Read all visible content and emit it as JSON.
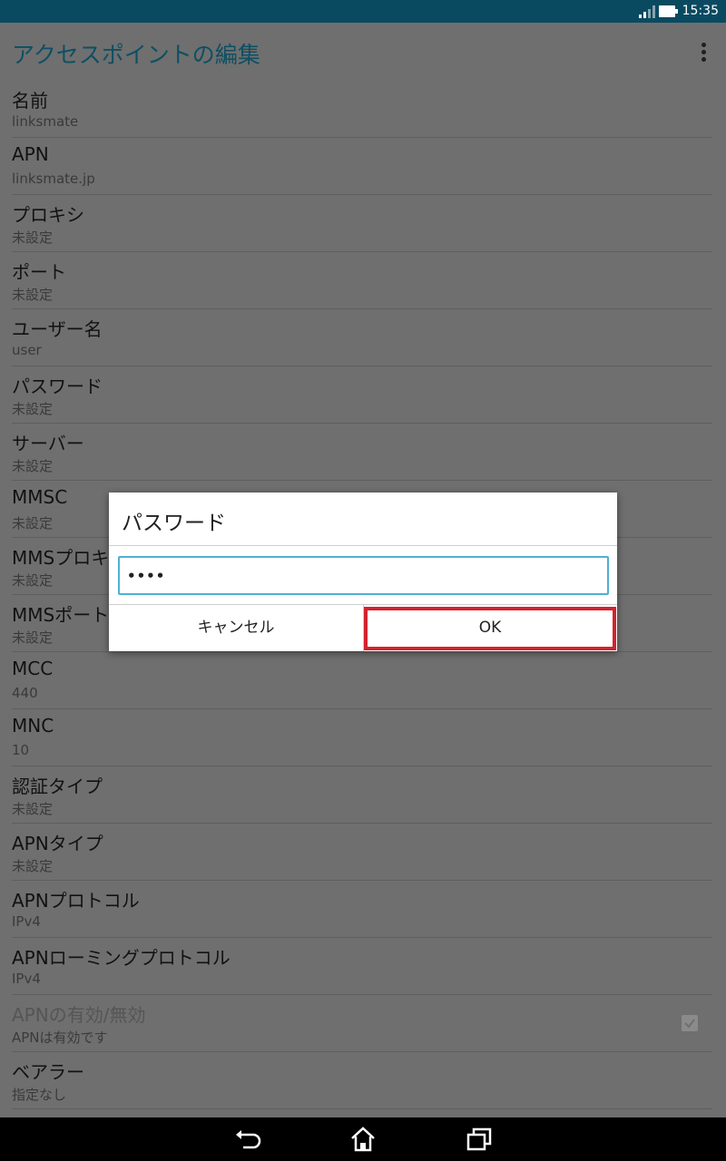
{
  "status_bar": {
    "time": "15:35"
  },
  "app_bar": {
    "title": "アクセスポイントの編集"
  },
  "settings": [
    {
      "title": "名前",
      "summary": "linksmate"
    },
    {
      "title": "APN",
      "summary": "linksmate.jp"
    },
    {
      "title": "プロキシ",
      "summary": "未設定"
    },
    {
      "title": "ポート",
      "summary": "未設定"
    },
    {
      "title": "ユーザー名",
      "summary": "user"
    },
    {
      "title": "パスワード",
      "summary": "未設定"
    },
    {
      "title": "サーバー",
      "summary": "未設定"
    },
    {
      "title": "MMSC",
      "summary": "未設定"
    },
    {
      "title": "MMSプロキシ",
      "summary": "未設定"
    },
    {
      "title": "MMSポート",
      "summary": "未設定"
    },
    {
      "title": "MCC",
      "summary": "440"
    },
    {
      "title": "MNC",
      "summary": "10"
    },
    {
      "title": "認証タイプ",
      "summary": "未設定"
    },
    {
      "title": "APNタイプ",
      "summary": "未設定"
    },
    {
      "title": "APNプロトコル",
      "summary": "IPv4"
    },
    {
      "title": "APNローミングプロトコル",
      "summary": "IPv4"
    },
    {
      "title": "APNの有効/無効",
      "summary": "APNは有効です",
      "checked": true,
      "disabled": true
    },
    {
      "title": "ベアラー",
      "summary": "指定なし"
    }
  ],
  "dialog": {
    "title": "パスワード",
    "input_value": "••••",
    "cancel_label": "キャンセル",
    "ok_label": "OK"
  },
  "icons": {
    "overflow": "more-vert-icon",
    "signal": "signal-icon",
    "battery": "battery-icon",
    "back": "back-icon",
    "home": "home-icon",
    "recents": "recents-icon",
    "checkbox": "check-icon"
  },
  "colors": {
    "status_bar": "#0a4a61",
    "title": "#0f4f63",
    "input_focus": "#4fb0d3",
    "highlight": "#d3232e"
  }
}
